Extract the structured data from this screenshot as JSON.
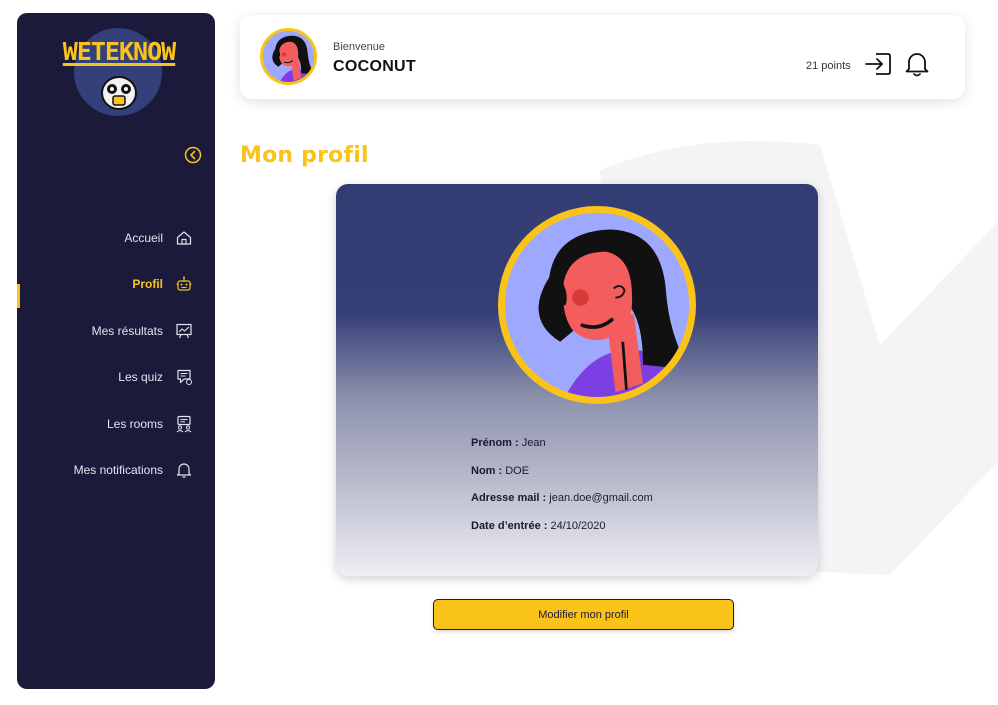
{
  "brand": {
    "logo_text": "WETEKNOW"
  },
  "colors": {
    "accent": "#f9c31a",
    "sidebar_bg": "#1b1a3b",
    "card_top": "#333d74"
  },
  "sidebar": {
    "items": [
      {
        "label": "Accueil",
        "icon": "home-icon"
      },
      {
        "label": "Profil",
        "icon": "robot-icon",
        "active": true
      },
      {
        "label": "Mes résultats",
        "icon": "chart-board-icon"
      },
      {
        "label": "Les quiz",
        "icon": "quiz-icon"
      },
      {
        "label": "Les rooms",
        "icon": "chat-users-icon"
      },
      {
        "label": "Mes notifications",
        "icon": "bell-icon"
      }
    ]
  },
  "header": {
    "welcome": "Bienvenue",
    "username": "COCONUT",
    "points": "21 points"
  },
  "page": {
    "title": "Mon profil"
  },
  "profile": {
    "first_name_label": "Prénom :",
    "first_name": " Jean",
    "last_name_label": "Nom :",
    "last_name": " DOE",
    "email_label": "Adresse mail :",
    "email": " jean.doe@gmail.com",
    "date_label": "Date d’entrée :",
    "date": " 24/10/2020"
  },
  "actions": {
    "edit_profile": "Modifier mon profil"
  }
}
